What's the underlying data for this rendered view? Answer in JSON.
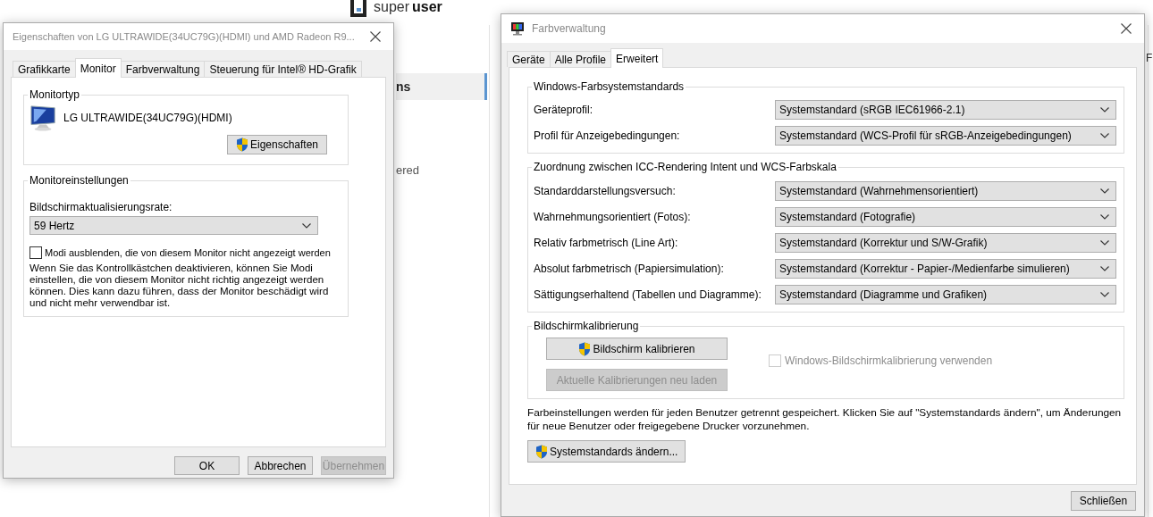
{
  "background_page": {
    "logo": {
      "word_1": "super",
      "word_2": "user"
    },
    "sidebar_item": {
      "label": "ns",
      "selected": true
    },
    "fragment_text": "ered",
    "right_edge_text": "F"
  },
  "properties_dialog": {
    "title": "Eigenschaften von LG ULTRAWIDE(34UC79G)(HDMI) und AMD Radeon R9...",
    "tabs": [
      {
        "label": "Grafikkarte",
        "selected": false
      },
      {
        "label": "Monitor",
        "selected": true
      },
      {
        "label": "Farbverwaltung",
        "selected": false
      },
      {
        "label": "Steuerung für Intel® HD-Grafik",
        "selected": false
      }
    ],
    "monitor_type": {
      "legend": "Monitortyp",
      "name": "LG ULTRAWIDE(34UC79G)(HDMI)",
      "button": {
        "label": "Eigenschaften",
        "shield": true,
        "disabled": false
      }
    },
    "monitor_settings": {
      "legend": "Monitoreinstellungen",
      "rate_label": "Bildschirmaktualisierungsrate:",
      "rate_value": "59 Hertz",
      "hide_modes": {
        "label": "Modi ausblenden, die von diesem Monitor nicht angezeigt werden",
        "checked": false,
        "disabled": false
      },
      "note": "Wenn Sie das Kontrollkästchen deaktivieren, können Sie Modi einstellen, die von diesem Monitor nicht richtig angezeigt werden können. Dies kann dazu führen, dass der Monitor beschädigt wird und nicht mehr verwendbar ist."
    },
    "buttons": [
      {
        "label": "OK",
        "disabled": false
      },
      {
        "label": "Abbrechen",
        "disabled": false
      },
      {
        "label": "Übernehmen",
        "disabled": true
      }
    ]
  },
  "color_dialog": {
    "title": "Farbverwaltung",
    "tabs": [
      {
        "label": "Geräte",
        "selected": false
      },
      {
        "label": "Alle Profile",
        "selected": false
      },
      {
        "label": "Erweitert",
        "selected": true
      }
    ],
    "groups": [
      {
        "legend": "Windows-Farbsystemstandards",
        "rows": [
          {
            "label": "Geräteprofil:",
            "value": "Systemstandard (sRGB IEC61966-2.1)"
          },
          {
            "label": "Profil für Anzeigebedingungen:",
            "value": "Systemstandard (WCS-Profil für sRGB-Anzeigebedingungen)"
          }
        ]
      },
      {
        "legend": "Zuordnung zwischen ICC-Rendering Intent und WCS-Farbskala",
        "rows": [
          {
            "label": "Standarddarstellungsversuch:",
            "value": "Systemstandard (Wahrnehmensorientiert)"
          },
          {
            "label": "Wahrnehmungsorientiert (Fotos):",
            "value": "Systemstandard (Fotografie)"
          },
          {
            "label": "Relativ farbmetrisch (Line Art):",
            "value": "Systemstandard (Korrektur und S/W-Grafik)"
          },
          {
            "label": "Absolut farbmetrisch (Papiersimulation):",
            "value": "Systemstandard (Korrektur - Papier-/Medienfarbe simulieren)"
          },
          {
            "label": "Sättigungserhaltend (Tabellen und Diagramme):",
            "value": "Systemstandard (Diagramme und Grafiken)"
          }
        ]
      }
    ],
    "calibration": {
      "legend": "Bildschirmkalibrierung",
      "calibrate_button": {
        "label": "Bildschirm kalibrieren",
        "shield": true,
        "disabled": false
      },
      "reload_button": {
        "label": "Aktuelle Kalibrierungen neu laden",
        "shield": false,
        "disabled": true
      },
      "use_calibration": {
        "label": "Windows-Bildschirmkalibrierung verwenden",
        "checked": false,
        "disabled": true
      }
    },
    "note": "Farbeinstellungen werden für jeden Benutzer getrennt gespeichert. Klicken Sie auf \"Systemstandards ändern\", um Änderungen für neue Benutzer oder freigegebene Drucker vorzunehmen.",
    "defaults_button": {
      "label": "Systemstandards ändern...",
      "shield": true,
      "disabled": false
    },
    "close_button": {
      "label": "Schließen",
      "disabled": false
    }
  }
}
